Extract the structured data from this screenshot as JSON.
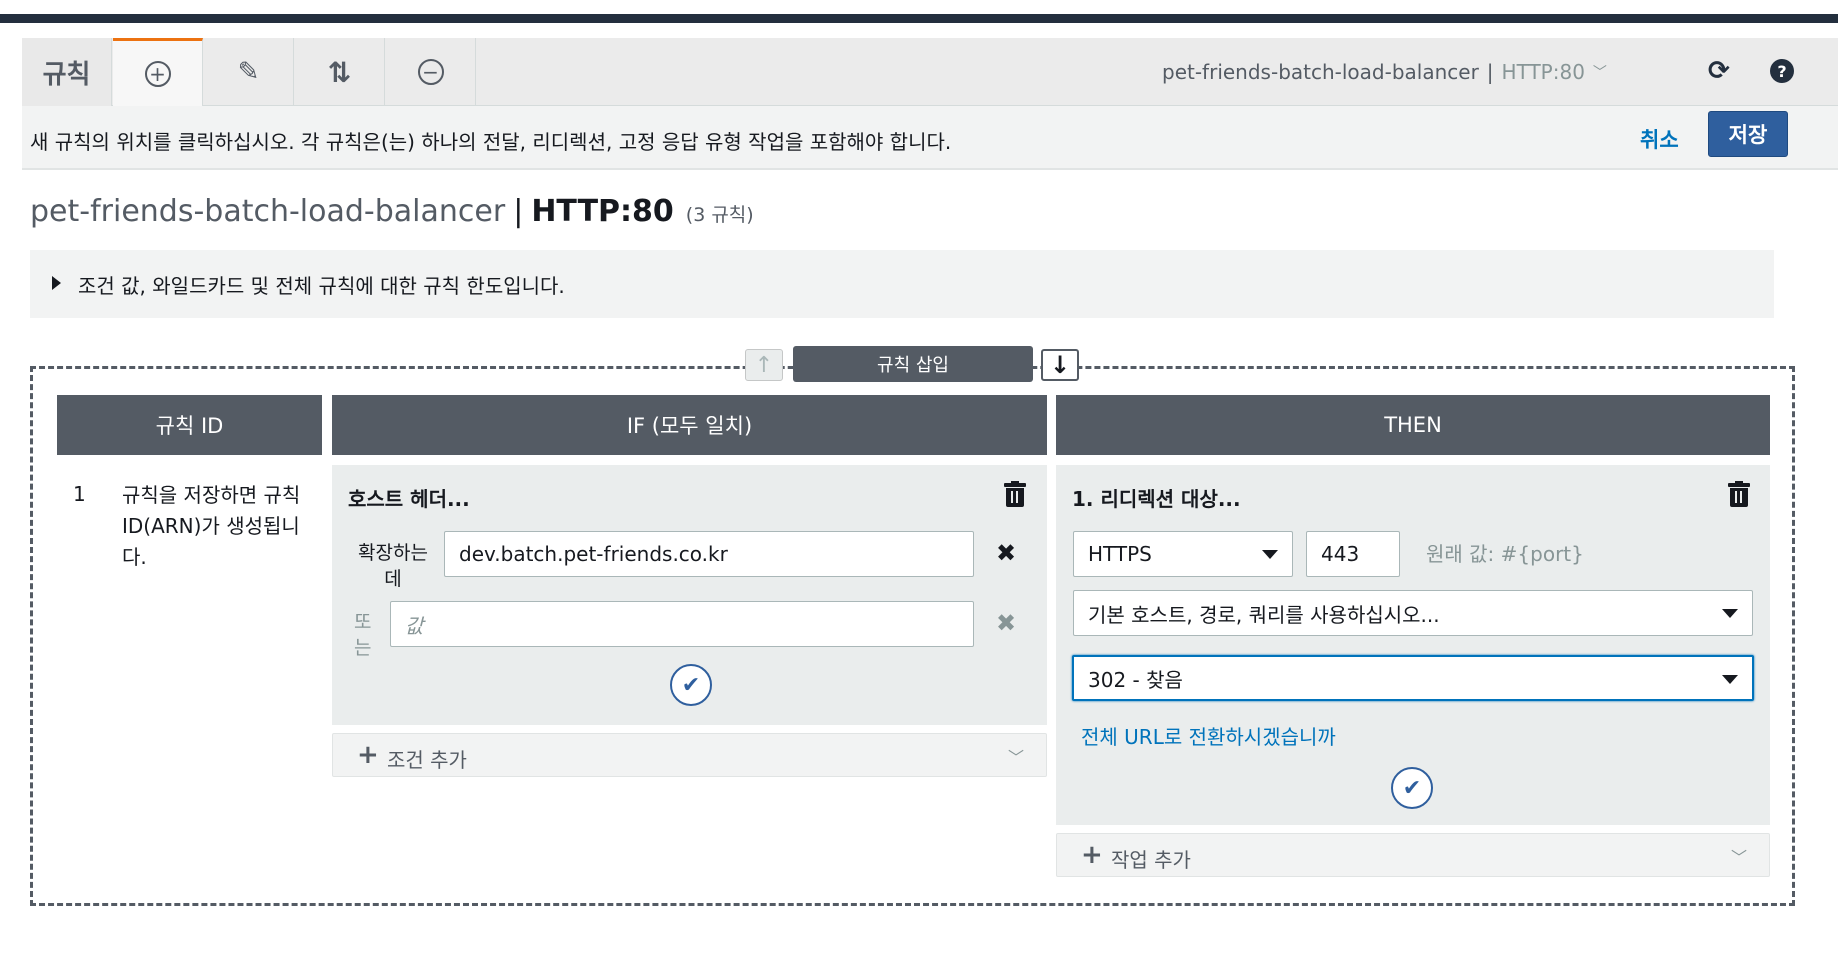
{
  "toolbar": {
    "title": "규칙",
    "tabs": [
      {
        "name": "add",
        "icon": "plus-circle-icon",
        "glyph": "+"
      },
      {
        "name": "edit",
        "icon": "pencil-icon",
        "glyph": "✎"
      },
      {
        "name": "reorder",
        "icon": "reorder-arrows-icon",
        "glyph": "⇅"
      },
      {
        "name": "remove",
        "icon": "minus-circle-icon",
        "glyph": "−"
      }
    ],
    "load_balancer": "pet-friends-batch-load-balancer",
    "separator": "|",
    "listener": "HTTP:80",
    "dropdown_glyph": "﹀",
    "refresh_glyph": "⟳",
    "help_glyph": "?"
  },
  "infobar": {
    "message": "새 규칙의 위치를 클릭하십시오. 각 규칙은(는) 하나의 전달, 리디렉션, 고정 응답 유형 작업을 포함해야 합니다.",
    "cancel_label": "취소",
    "save_label": "저장"
  },
  "heading": {
    "load_balancer": "pet-friends-batch-load-balancer",
    "separator": "|",
    "listener": "HTTP:80",
    "rule_count": "(3 규칙)"
  },
  "limits": {
    "text": "조건 값, 와일드카드 및 전체 규칙에 대한 규칙 한도입니다."
  },
  "insert": {
    "label": "규칙 삽입",
    "up_glyph": "↑",
    "down_glyph": "↓"
  },
  "columns": {
    "rule_id": "규칙 ID",
    "if": "IF (모두 일치)",
    "then": "THEN"
  },
  "rule": {
    "number": "1",
    "description": "규칙을 저장하면 규칙 ID(ARN)가 생성됩니다."
  },
  "condition": {
    "title": "호스트 헤더...",
    "label": "확장하는데",
    "value": "dev.batch.pet-friends.co.kr",
    "or_label": "또는",
    "placeholder": "값",
    "remove_glyph": "✖",
    "confirm_glyph": "✔",
    "add_label": "조건 추가"
  },
  "action": {
    "title": "1. 리디렉션 대상...",
    "protocol": "HTTPS",
    "port": "443",
    "original_value": "원래 값: #{port}",
    "host_path_query": "기본 호스트, 경로, 쿼리를 사용하십시오...",
    "status_code": "302 - 찾음",
    "switch_link": "전체 URL로 전환하시겠습니까",
    "confirm_glyph": "✔",
    "add_label": "작업 추가"
  },
  "colors": {
    "brand_dark": "#232f3e",
    "accent_orange": "#ec7211",
    "primary_button": "#2f5f9e",
    "link": "#0073bb",
    "header_gray": "#545b64"
  }
}
